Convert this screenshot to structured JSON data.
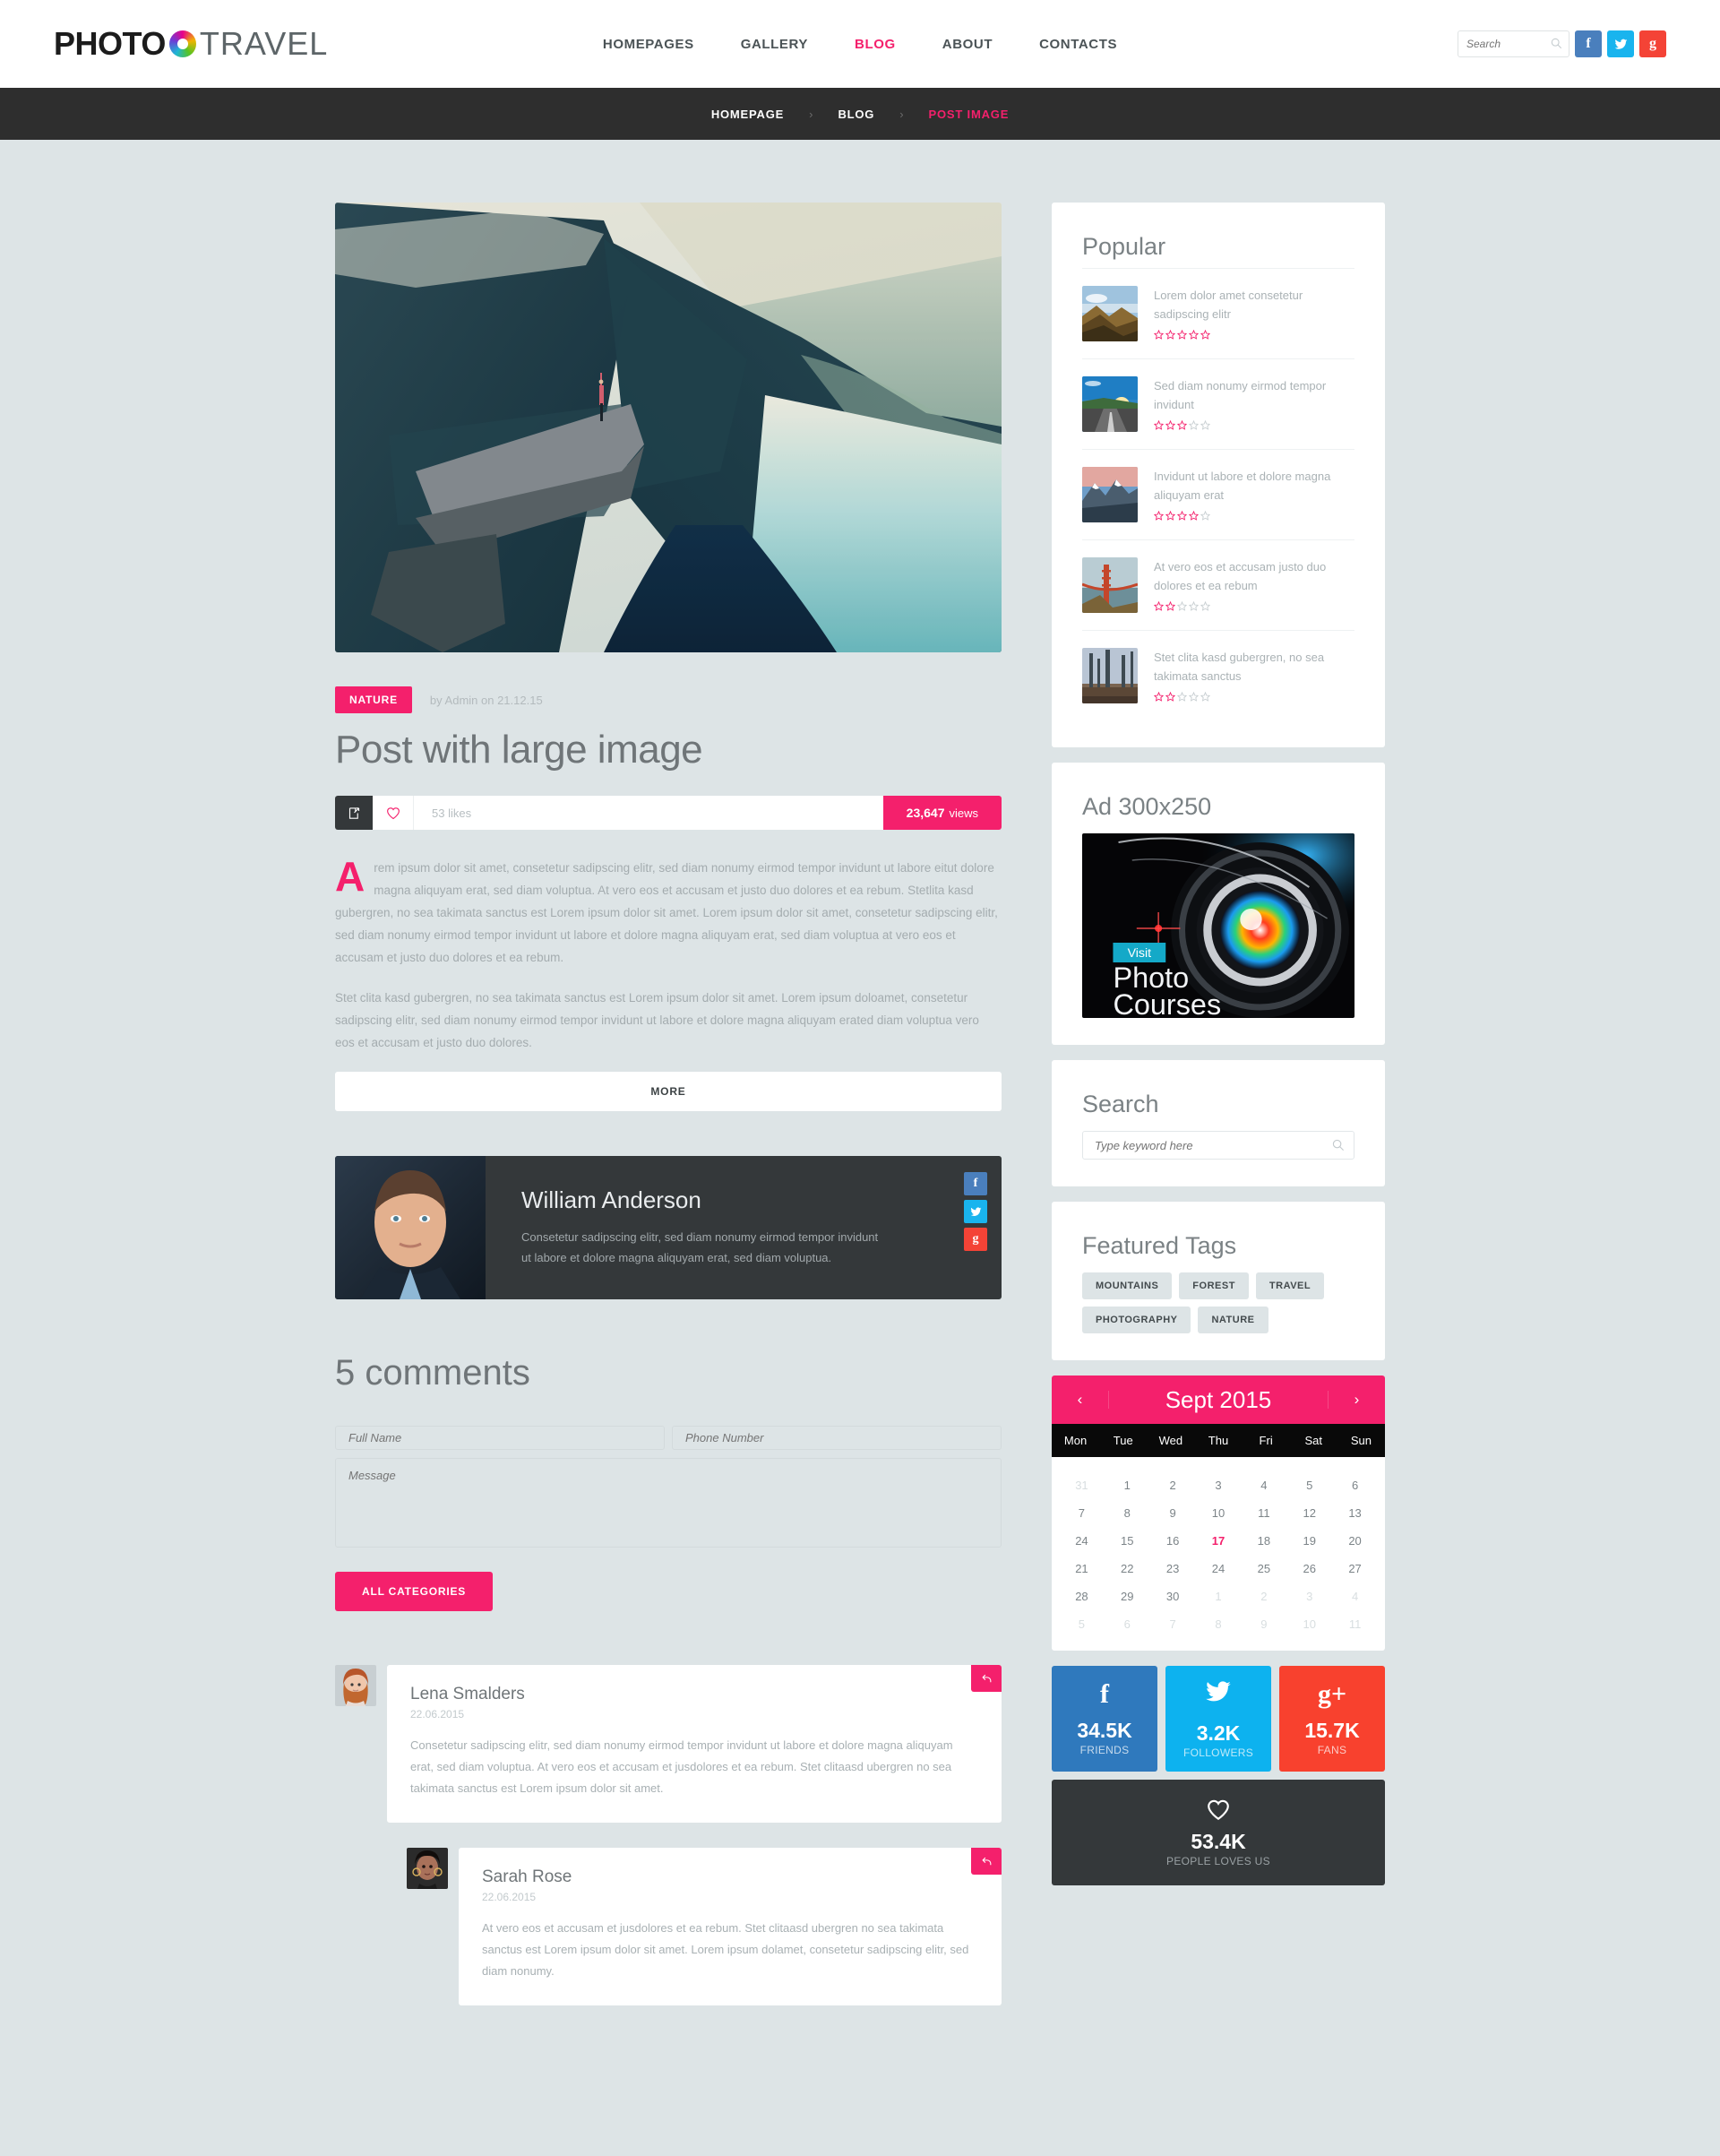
{
  "brand": {
    "part1": "PHOTO",
    "part2": "TRAVEL"
  },
  "nav": {
    "items": [
      {
        "label": "HOMEPAGES",
        "active": false
      },
      {
        "label": "GALLERY",
        "active": false
      },
      {
        "label": "BLOG",
        "active": true
      },
      {
        "label": "ABOUT",
        "active": false
      },
      {
        "label": "CONTACTS",
        "active": false
      }
    ]
  },
  "header_search": {
    "placeholder": "Search",
    "value": ""
  },
  "header_socials": [
    {
      "name": "facebook",
      "glyph": "f"
    },
    {
      "name": "twitter",
      "glyph": "🐦"
    },
    {
      "name": "google-plus",
      "glyph": "g"
    }
  ],
  "breadcrumb": {
    "items": [
      {
        "label": "HOMEPAGE",
        "current": false
      },
      {
        "label": "BLOG",
        "current": false
      },
      {
        "label": "POST IMAGE",
        "current": true
      }
    ],
    "separator": "›"
  },
  "post": {
    "category": "NATURE",
    "byline": "by Admin on 21.12.15",
    "title": "Post with large image",
    "likes": "53 likes",
    "views_number": "23,647",
    "views_label": "views",
    "dropcap": "A",
    "paragraph1": "rem ipsum dolor sit amet, consetetur sadipscing elitr, sed diam nonumy eirmod tempor invidunt ut labore eitut dolore magna aliquyam erat, sed diam voluptua. At vero eos et accusam et justo duo dolores et ea rebum. Stetlita kasd gubergren, no sea takimata sanctus est Lorem ipsum dolor sit amet. Lorem ipsum dolor sit amet, consetetur sadipscing elitr, sed diam nonumy eirmod tempor invidunt ut labore et dolore magna aliquyam erat, sed diam voluptua at vero eos et accusam et justo duo dolores et ea rebum.",
    "paragraph2": "Stet clita kasd gubergren, no sea takimata sanctus est Lorem ipsum dolor sit amet. Lorem ipsum doloamet, consetetur sadipscing elitr, sed diam nonumy eirmod tempor invidunt ut labore et dolore magna aliquyam erated diam voluptua vero eos et accusam et justo duo dolores.",
    "more_label": "MORE"
  },
  "author": {
    "name": "William Anderson",
    "bio": "Consetetur sadipscing elitr, sed diam nonumy eirmod tempor invidunt ut labore et dolore magna aliquyam erat, sed diam voluptua.",
    "socials": [
      {
        "name": "facebook",
        "glyph": "f"
      },
      {
        "name": "twitter",
        "glyph": "🐦"
      },
      {
        "name": "google-plus",
        "glyph": "g"
      }
    ]
  },
  "comments": {
    "heading": "5 comments",
    "form": {
      "name_placeholder": "Full Name",
      "phone_placeholder": "Phone Number",
      "message_placeholder": "Message",
      "submit_label": "ALL CATEGORIES"
    },
    "items": [
      {
        "name": "Lena Smalders",
        "date": "22.06.2015",
        "text": "Consetetur sadipscing elitr, sed diam nonumy eirmod tempor invidunt ut labore et dolore magna aliquyam erat, sed diam voluptua. At vero eos et accusam et jusdolores et ea rebum. Stet clitaasd ubergren no sea takimata sanctus est Lorem ipsum dolor sit amet.",
        "reply": false
      },
      {
        "name": "Sarah Rose",
        "date": "22.06.2015",
        "text": "At vero eos et accusam et jusdolores et ea rebum. Stet clitaasd ubergren no sea takimata sanctus est Lorem ipsum dolor sit amet. Lorem ipsum dolamet, consetetur sadipscing elitr, sed diam nonumy.",
        "reply": true
      }
    ]
  },
  "sidebar": {
    "popular": {
      "title": "Popular",
      "items": [
        {
          "text": "Lorem dolor amet consetetur sadipscing elitr",
          "rating": 5,
          "thumb": "mountain-ridge"
        },
        {
          "text": "Sed diam nonumy eirmod tempor invidunt",
          "rating": 3,
          "thumb": "road-sunset"
        },
        {
          "text": "Invidunt ut labore et dolore magna aliquyam erat",
          "rating": 4,
          "thumb": "snow-peak"
        },
        {
          "text": "At vero eos et accusam justo duo dolores et ea rebum",
          "rating": 2,
          "thumb": "golden-gate"
        },
        {
          "text": "Stet clita kasd gubergren, no sea takimata sanctus",
          "rating": 2,
          "thumb": "winter-forest"
        }
      ]
    },
    "ad": {
      "title": "Ad 300x250",
      "button": "Visit",
      "line1": "Photo",
      "line2": "Courses"
    },
    "search": {
      "title": "Search",
      "placeholder": "Type keyword here",
      "value": ""
    },
    "tags": {
      "title": "Featured Tags",
      "items": [
        "MOUNTAINS",
        "FOREST",
        "TRAVEL",
        "PHOTOGRAPHY",
        "NATURE"
      ]
    },
    "calendar": {
      "month": "Sept 2015",
      "prev": "‹",
      "next": "›",
      "dow": [
        "Mon",
        "Tue",
        "Wed",
        "Thu",
        "Fri",
        "Sat",
        "Sun"
      ],
      "weeks": [
        [
          {
            "d": "31",
            "m": true
          },
          {
            "d": "1"
          },
          {
            "d": "2"
          },
          {
            "d": "3"
          },
          {
            "d": "4"
          },
          {
            "d": "5"
          },
          {
            "d": "6"
          }
        ],
        [
          {
            "d": "7"
          },
          {
            "d": "8"
          },
          {
            "d": "9"
          },
          {
            "d": "10"
          },
          {
            "d": "11"
          },
          {
            "d": "12"
          },
          {
            "d": "13"
          }
        ],
        [
          {
            "d": "24"
          },
          {
            "d": "15"
          },
          {
            "d": "16"
          },
          {
            "d": "17",
            "today": true
          },
          {
            "d": "18"
          },
          {
            "d": "19"
          },
          {
            "d": "20"
          }
        ],
        [
          {
            "d": "21"
          },
          {
            "d": "22"
          },
          {
            "d": "23"
          },
          {
            "d": "24"
          },
          {
            "d": "25"
          },
          {
            "d": "26"
          },
          {
            "d": "27"
          }
        ],
        [
          {
            "d": "28"
          },
          {
            "d": "29"
          },
          {
            "d": "30"
          },
          {
            "d": "1",
            "m": true
          },
          {
            "d": "2",
            "m": true
          },
          {
            "d": "3",
            "m": true
          },
          {
            "d": "4",
            "m": true
          }
        ],
        [
          {
            "d": "5",
            "m": true
          },
          {
            "d": "6",
            "m": true
          },
          {
            "d": "7",
            "m": true
          },
          {
            "d": "8",
            "m": true
          },
          {
            "d": "9",
            "m": true
          },
          {
            "d": "10",
            "m": true
          },
          {
            "d": "11",
            "m": true
          }
        ]
      ]
    },
    "social_counters": [
      {
        "network": "facebook",
        "glyph": "f",
        "count": "34.5K",
        "label": "FRIENDS",
        "color": "#2f79bd"
      },
      {
        "network": "twitter",
        "glyph": "🐦",
        "count": "3.2K",
        "label": "FOLLOWERS",
        "color": "#0db2ef"
      },
      {
        "network": "google-plus",
        "glyph": "g+",
        "count": "15.7K",
        "label": "FANS",
        "color": "#f8412e"
      }
    ],
    "love": {
      "count": "53.4K",
      "label": "PEOPLE LOVES US"
    }
  },
  "colors": {
    "accent": "#f4206c",
    "dark": "#34383a",
    "page_bg": "#dde4e6"
  }
}
